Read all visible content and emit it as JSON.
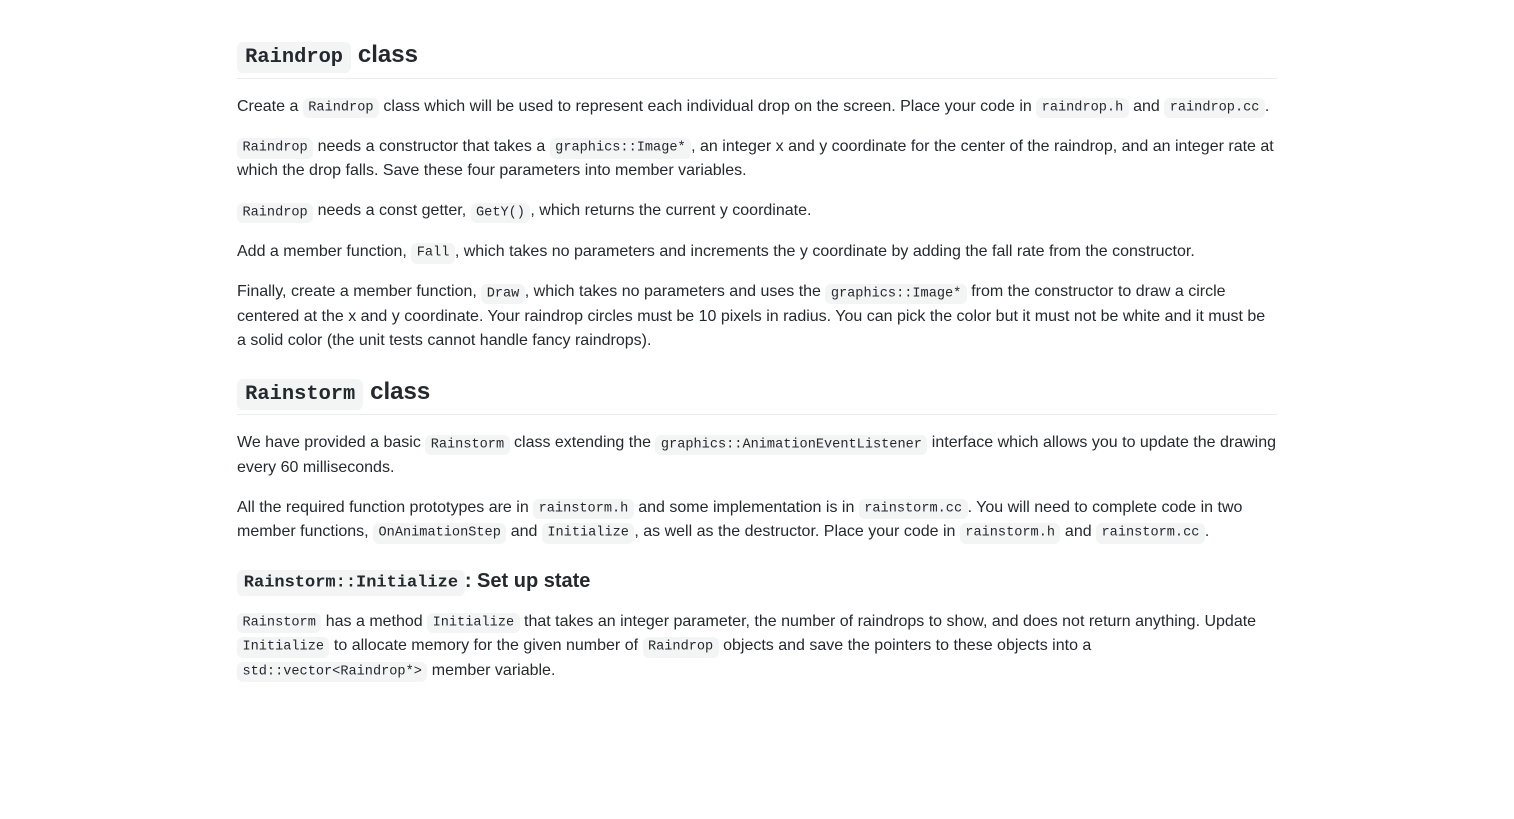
{
  "section1": {
    "heading_code": "Raindrop",
    "heading_suffix": " class",
    "p1": {
      "t1": "Create a ",
      "c1": "Raindrop",
      "t2": " class which will be used to represent each individual drop on the screen. Place your code in ",
      "c2": "raindrop.h",
      "t3": " and ",
      "c3": "raindrop.cc",
      "t4": "."
    },
    "p2": {
      "c1": "Raindrop",
      "t1": " needs a constructor that takes a ",
      "c2": "graphics::Image*",
      "t2": ", an integer x and y coordinate for the center of the raindrop, and an integer rate at which the drop falls. Save these four parameters into member variables."
    },
    "p3": {
      "c1": "Raindrop",
      "t1": " needs a const getter, ",
      "c2": "GetY()",
      "t2": ", which returns the current y coordinate."
    },
    "p4": {
      "t1": "Add a member function, ",
      "c1": "Fall",
      "t2": ", which takes no parameters and increments the y coordinate by adding the fall rate from the constructor."
    },
    "p5": {
      "t1": "Finally, create a member function, ",
      "c1": "Draw",
      "t2": ", which takes no parameters and uses the ",
      "c2": "graphics::Image*",
      "t3": " from the constructor to draw a circle centered at the x and y coordinate. Your raindrop circles must be 10 pixels in radius. You can pick the color but it must not be white and it must be a solid color (the unit tests cannot handle fancy raindrops)."
    }
  },
  "section2": {
    "heading_code": "Rainstorm",
    "heading_suffix": " class",
    "p1": {
      "t1": "We have provided a basic ",
      "c1": "Rainstorm",
      "t2": " class extending the ",
      "c2": "graphics::AnimationEventListener",
      "t3": " interface which allows you to update the drawing every 60 milliseconds."
    },
    "p2": {
      "t1": "All the required function prototypes are in ",
      "c1": "rainstorm.h",
      "t2": " and some implementation is in ",
      "c2": "rainstorm.cc",
      "t3": ". You will need to complete code in two member functions, ",
      "c3": "OnAnimationStep",
      "t4": " and ",
      "c4": "Initialize",
      "t5": ", as well as the destructor. Place your code in ",
      "c5": "rainstorm.h",
      "t6": " and ",
      "c6": "rainstorm.cc",
      "t7": "."
    }
  },
  "section3": {
    "heading_code": "Rainstorm::Initialize",
    "heading_suffix": ": Set up state",
    "p1": {
      "c1": "Rainstorm",
      "t1": " has a method ",
      "c2": "Initialize",
      "t2": " that takes an integer parameter, the number of raindrops to show, and does not return anything. Update ",
      "c3": "Initialize",
      "t3": " to allocate memory for the given number of ",
      "c4": "Raindrop",
      "t4": " objects and save the pointers to these objects into a ",
      "c5": "std::vector<Raindrop*>",
      "t5": " member variable."
    }
  }
}
